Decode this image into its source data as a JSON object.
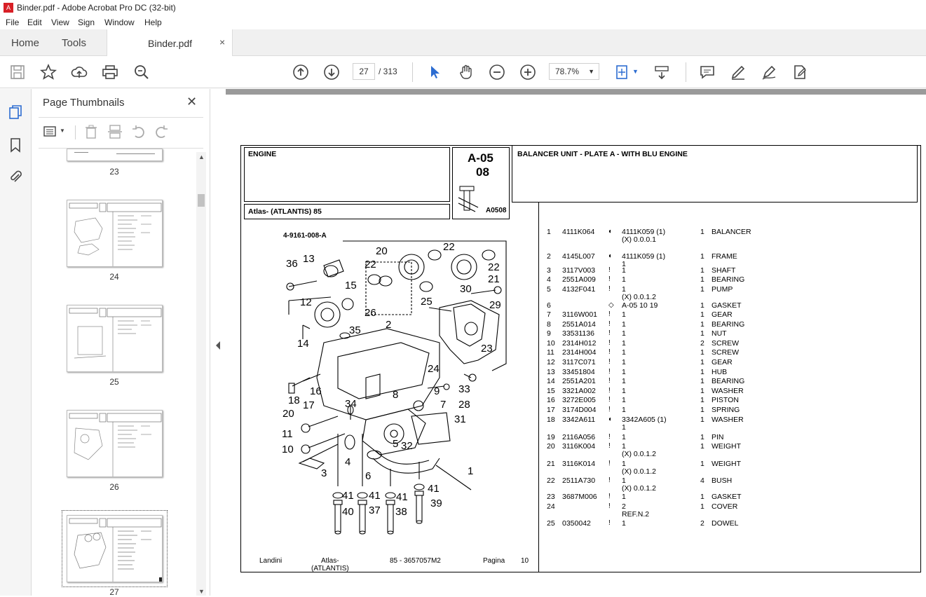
{
  "window": {
    "title": "Binder.pdf - Adobe Acrobat Pro DC (32-bit)"
  },
  "menu": [
    "File",
    "Edit",
    "View",
    "Sign",
    "Window",
    "Help"
  ],
  "tabs": {
    "home": "Home",
    "tools": "Tools",
    "document": "Binder.pdf",
    "close": "×"
  },
  "toolbar": {
    "current_page": "27",
    "total_pages": "/ 313",
    "zoom": "78.7%"
  },
  "thumbnails_panel": {
    "title": "Page Thumbnails",
    "close": "✕",
    "pages": [
      "23",
      "24",
      "25",
      "26",
      "27"
    ],
    "selected_page": "27"
  },
  "document": {
    "header_left": "ENGINE",
    "code_top": "A-05",
    "code_bottom": "08",
    "code_ref": "A0508",
    "header_right": "BALANCER UNIT - PLATE A - WITH BLU ENGINE",
    "model": "Atlas- (ATLANTIS) 85",
    "diagram_ref": "4-9161-008-A",
    "callouts": [
      "20",
      "22",
      "13",
      "36",
      "15",
      "12",
      "14",
      "26",
      "35",
      "2",
      "22",
      "21",
      "30",
      "29",
      "25",
      "23",
      "24",
      "9",
      "33",
      "16",
      "17",
      "18",
      "20",
      "34",
      "8",
      "7",
      "28",
      "31",
      "11",
      "10",
      "4",
      "5",
      "32",
      "3",
      "6",
      "1",
      "41",
      "41",
      "41",
      "41",
      "40",
      "37",
      "38",
      "39"
    ],
    "parts": [
      {
        "ref": "1",
        "code": "4111K064",
        "sym": "◐",
        "alt": "4111K059  (1)",
        "qty": "1",
        "desc": "BALANCER",
        "note": "(X) 0.0.0.1"
      },
      {
        "ref": "2",
        "code": "4145L007",
        "sym": "◐",
        "alt": "4111K059  (1)",
        "qty": "1",
        "desc": "FRAME",
        "note": "1"
      },
      {
        "ref": "3",
        "code": "3117V003",
        "sym": "!",
        "alt": "1",
        "qty": "1",
        "desc": "SHAFT",
        "note": ""
      },
      {
        "ref": "4",
        "code": "2551A009",
        "sym": "!",
        "alt": "1",
        "qty": "1",
        "desc": "BEARING",
        "note": ""
      },
      {
        "ref": "5",
        "code": "4132F041",
        "sym": "!",
        "alt": "1",
        "qty": "1",
        "desc": "PUMP",
        "note": "(X) 0.0.1.2"
      },
      {
        "ref": "6",
        "code": "",
        "sym": "◇",
        "alt": "A-05 10 19",
        "qty": "1",
        "desc": "GASKET",
        "note": ""
      },
      {
        "ref": "7",
        "code": "3116W001",
        "sym": "!",
        "alt": "1",
        "qty": "1",
        "desc": "GEAR",
        "note": ""
      },
      {
        "ref": "8",
        "code": "2551A014",
        "sym": "!",
        "alt": "1",
        "qty": "1",
        "desc": "BEARING",
        "note": ""
      },
      {
        "ref": "9",
        "code": "33531136",
        "sym": "!",
        "alt": "1",
        "qty": "1",
        "desc": "NUT",
        "note": ""
      },
      {
        "ref": "10",
        "code": "2314H012",
        "sym": "!",
        "alt": "1",
        "qty": "2",
        "desc": "SCREW",
        "note": ""
      },
      {
        "ref": "11",
        "code": "2314H004",
        "sym": "!",
        "alt": "1",
        "qty": "1",
        "desc": "SCREW",
        "note": ""
      },
      {
        "ref": "12",
        "code": "3117C071",
        "sym": "!",
        "alt": "1",
        "qty": "1",
        "desc": "GEAR",
        "note": ""
      },
      {
        "ref": "13",
        "code": "33451804",
        "sym": "!",
        "alt": "1",
        "qty": "1",
        "desc": "HUB",
        "note": ""
      },
      {
        "ref": "14",
        "code": "2551A201",
        "sym": "!",
        "alt": "1",
        "qty": "1",
        "desc": "BEARING",
        "note": ""
      },
      {
        "ref": "15",
        "code": "3321A002",
        "sym": "!",
        "alt": "1",
        "qty": "1",
        "desc": "WASHER",
        "note": ""
      },
      {
        "ref": "16",
        "code": "3272E005",
        "sym": "!",
        "alt": "1",
        "qty": "1",
        "desc": "PISTON",
        "note": ""
      },
      {
        "ref": "17",
        "code": "3174D004",
        "sym": "!",
        "alt": "1",
        "qty": "1",
        "desc": "SPRING",
        "note": ""
      },
      {
        "ref": "18",
        "code": "3342A611",
        "sym": "◐",
        "alt": "3342A605  (1)",
        "qty": "1",
        "desc": "WASHER",
        "note": "1"
      },
      {
        "ref": "19",
        "code": "2116A056",
        "sym": "!",
        "alt": "1",
        "qty": "1",
        "desc": "PIN",
        "note": ""
      },
      {
        "ref": "20",
        "code": "3116K004",
        "sym": "!",
        "alt": "1",
        "qty": "1",
        "desc": "WEIGHT",
        "note": "(X) 0.0.1.2"
      },
      {
        "ref": "21",
        "code": "3116K014",
        "sym": "!",
        "alt": "1",
        "qty": "1",
        "desc": "WEIGHT",
        "note": "(X) 0.0.1.2"
      },
      {
        "ref": "22",
        "code": "2511A730",
        "sym": "!",
        "alt": "1",
        "qty": "4",
        "desc": "BUSH",
        "note": "(X) 0.0.1.2"
      },
      {
        "ref": "23",
        "code": "3687M006",
        "sym": "!",
        "alt": "1",
        "qty": "1",
        "desc": "GASKET",
        "note": ""
      },
      {
        "ref": "24",
        "code": "",
        "sym": "!",
        "alt": "2",
        "qty": "1",
        "desc": "COVER",
        "note": "REF.N.2"
      },
      {
        "ref": "25",
        "code": "0350042",
        "sym": "!",
        "alt": "1",
        "qty": "2",
        "desc": "DOWEL",
        "note": ""
      }
    ],
    "footer": {
      "brand": "Landini",
      "model_line1": "Atlas-",
      "model_line2": "(ATLANTIS)",
      "code": "85 - 3657057M2",
      "page_label": "Pagina",
      "page_number": "10"
    }
  },
  "colors": {
    "accent_red": "#d81f26",
    "icon_blue": "#2c6cd1",
    "panel_gray": "#f5f5f5"
  }
}
